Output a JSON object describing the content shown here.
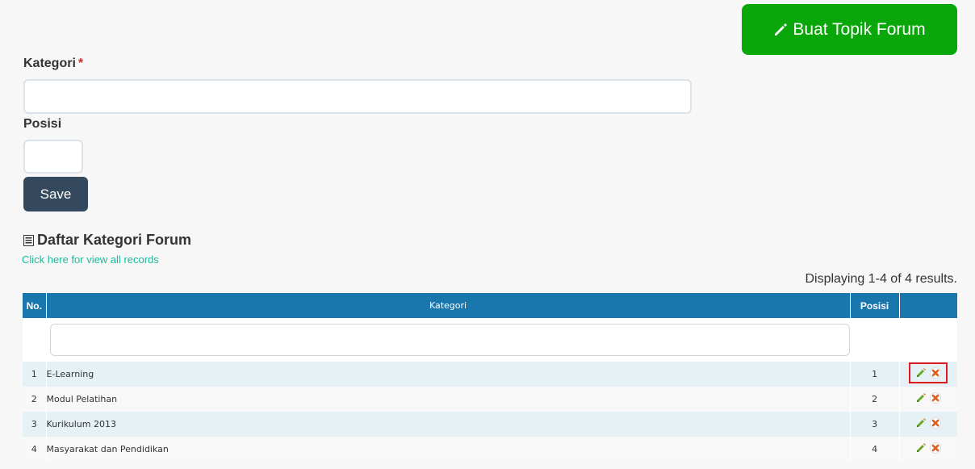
{
  "header": {
    "create_button_label": "Buat Topik Forum",
    "create_button_icon": "pencil-icon"
  },
  "form": {
    "kategori_label": "Kategori",
    "required_marker": "*",
    "kategori_value": "",
    "posisi_label": "Posisi",
    "posisi_value": "",
    "save_label": "Save"
  },
  "list": {
    "title": "Daftar Kategori Forum",
    "title_icon": "list-icon",
    "view_all_link": "Click here for view all records",
    "summary": "Displaying 1-4 of 4 results."
  },
  "table": {
    "columns": {
      "no": "No.",
      "kategori": "Kategori",
      "posisi": "Posisi",
      "actions": ""
    },
    "filter_value": "",
    "rows": [
      {
        "no": "1",
        "kategori": "E-Learning",
        "posisi": "1"
      },
      {
        "no": "2",
        "kategori": "Modul Pelatihan",
        "posisi": "2"
      },
      {
        "no": "3",
        "kategori": "Kurikulum 2013",
        "posisi": "3"
      },
      {
        "no": "4",
        "kategori": "Masyarakat dan Pendidikan",
        "posisi": "4"
      }
    ],
    "row_action_icons": [
      "pencil-icon",
      "delete-icon"
    ]
  },
  "colors": {
    "create_button": "#0aa70a",
    "save_button": "#34495e",
    "table_header": "#1a77ae",
    "link": "#1abc9c",
    "highlight": "#e0191f"
  }
}
